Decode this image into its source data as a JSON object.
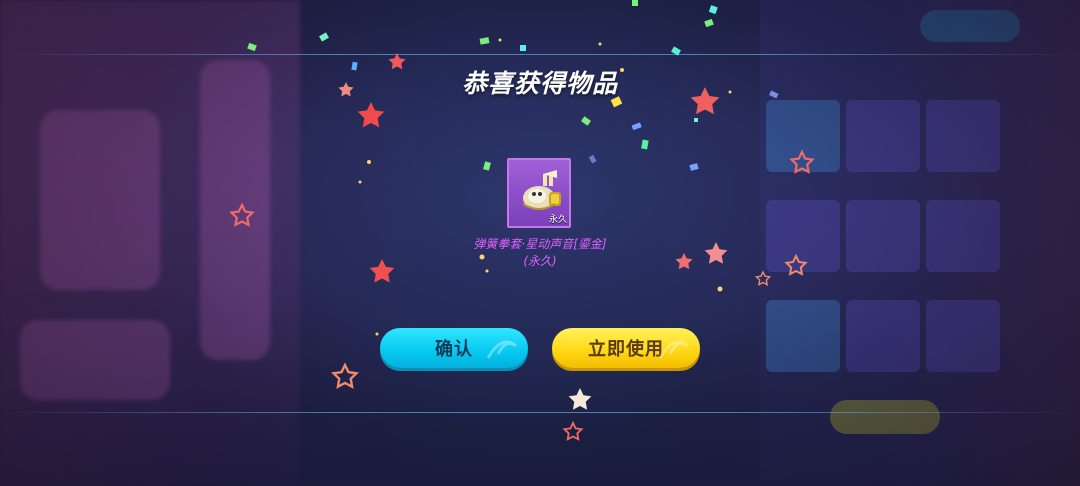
{
  "popup": {
    "title": "恭喜获得物品",
    "item": {
      "icon": "spring-glove-icon",
      "duration_tag": "永久",
      "name_line1": "弹簧拳套·星动声音[鎏金]",
      "name_line2": "(永久)"
    },
    "buttons": {
      "confirm_label": "确认",
      "use_now_label": "立即使用"
    }
  },
  "colors": {
    "confirm_button": "#06c8f0",
    "use_button": "#ffd712",
    "item_name": "#e060ff",
    "item_card": "#8a4fc8"
  }
}
